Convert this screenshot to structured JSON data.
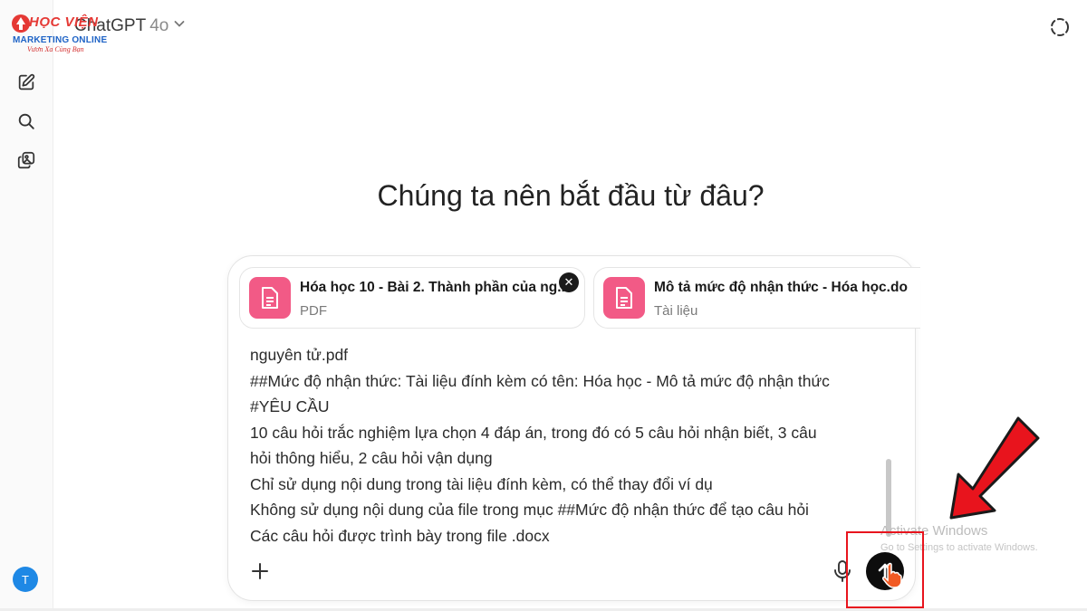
{
  "logo": {
    "brand_top": "HỌC VIỆN",
    "brand_main": "MARKETING ONLINE",
    "slogan": "Vươn Xa Cùng Bạn"
  },
  "header": {
    "model_name": "ChatGPT",
    "model_version": "4o",
    "model_icon": "chevron-down-icon",
    "right_icon": "dashed-circle-icon"
  },
  "sidebar": {
    "icons": [
      "new-chat-icon",
      "search-icon",
      "library-icon"
    ],
    "avatar_initial": "T"
  },
  "main": {
    "heading": "Chúng ta nên bắt đầu từ đâu?"
  },
  "composer": {
    "attachments": [
      {
        "name": "Hóa học 10 - Bài 2. Thành phần của ng...",
        "type": "PDF",
        "icon": "document-icon"
      },
      {
        "name": "Mô tả mức độ nhận thức - Hóa học.do",
        "type": "Tài liệu",
        "icon": "document-icon"
      }
    ],
    "message_lines": [
      "nguyên tử.pdf",
      "##Mức độ nhận thức: Tài liệu đính kèm có tên: Hóa học - Mô tả mức độ nhận thức",
      "#YÊU CẦU",
      "10 câu hỏi trắc nghiệm lựa chọn 4 đáp án, trong đó có 5 câu hỏi nhận biết, 3 câu",
      "hỏi thông hiểu, 2 câu hỏi vận dụng",
      "Chỉ sử dụng nội dung trong tài liệu đính kèm, có thể thay đổi ví dụ",
      "Không sử dụng nội dung của file trong mục ##Mức độ nhận thức để tạo câu hỏi",
      "Các câu hỏi được trình bày trong file .docx"
    ],
    "plus_icon": "plus-icon",
    "mic_icon": "microphone-icon",
    "send_icon": "arrow-up-icon"
  },
  "overlay": {
    "watermark_title": "Activate Windows",
    "watermark_sub": "Go to Settings to activate Windows.",
    "highlight_color": "#e8141d",
    "arrow_color": "#e8141d"
  }
}
